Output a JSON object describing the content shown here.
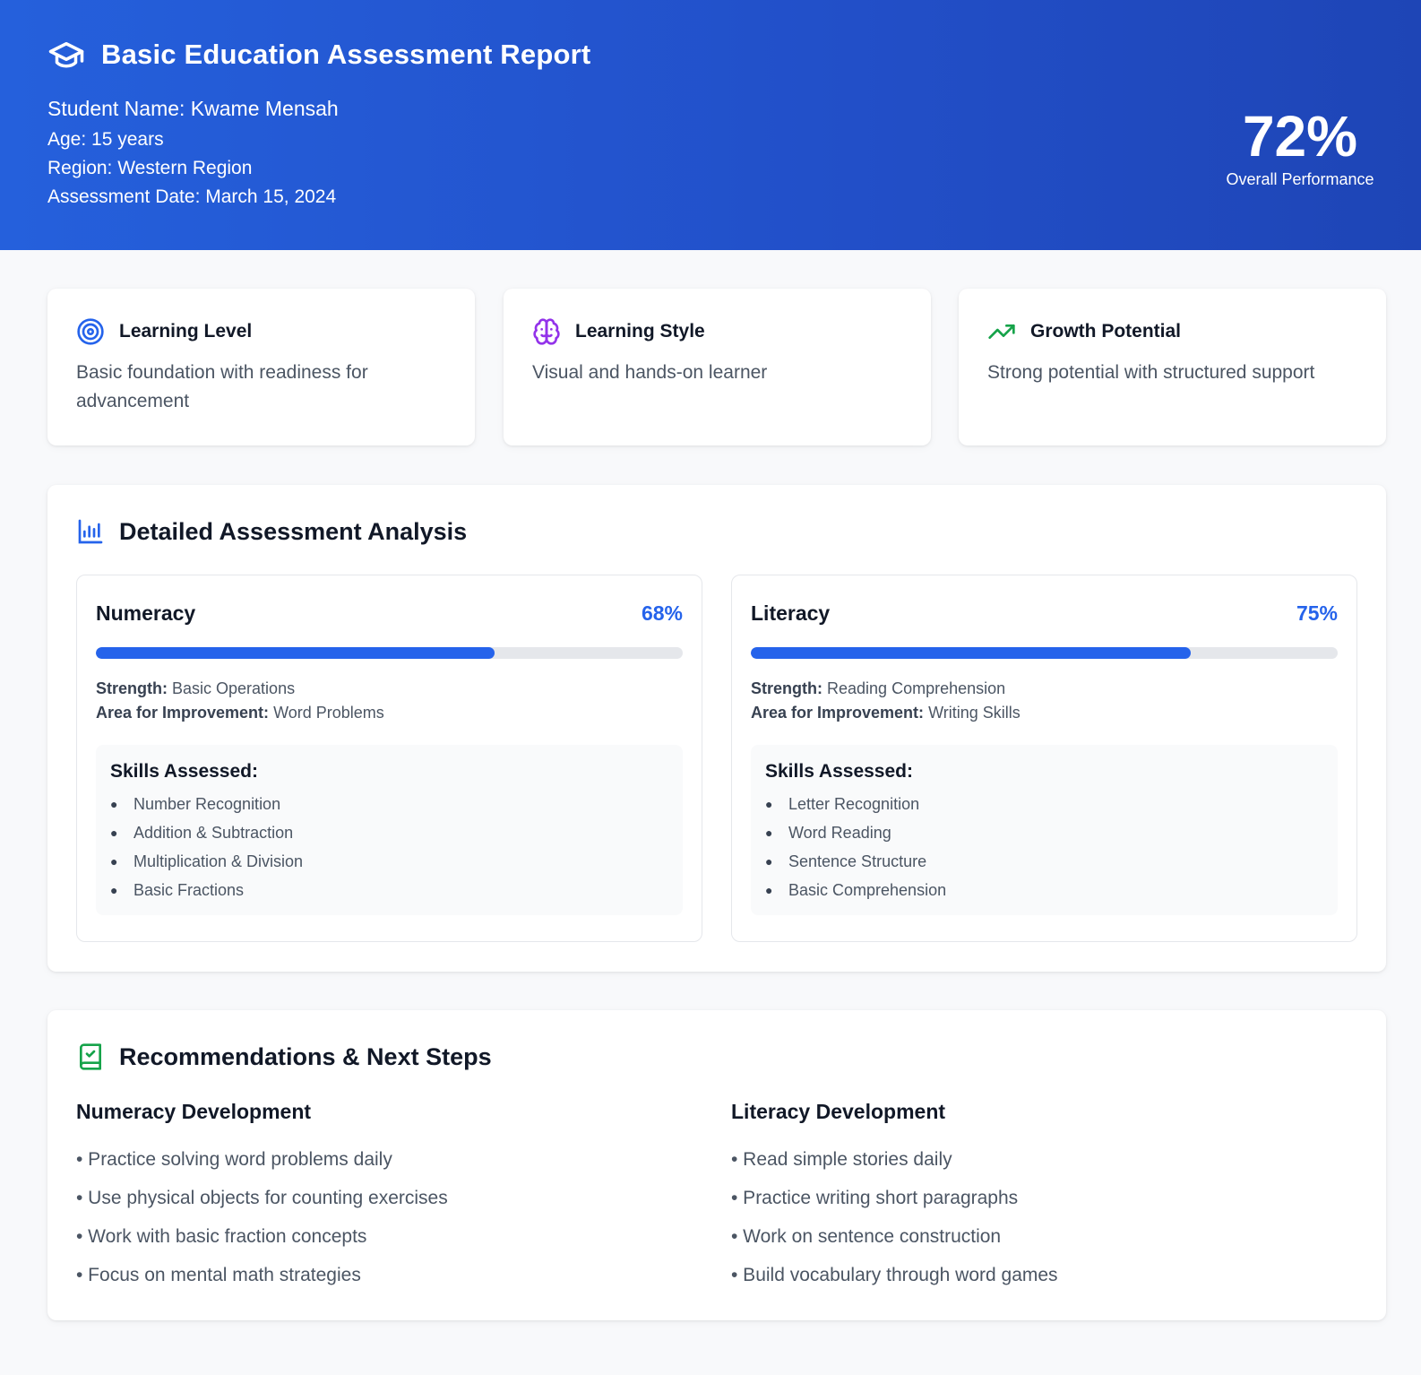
{
  "header": {
    "title": "Basic Education Assessment Report",
    "student_name": "Student Name: Kwame Mensah",
    "age": "Age: 15 years",
    "region": "Region: Western Region",
    "assessment_date": "Assessment Date: March 15, 2024",
    "overall_value": "72%",
    "overall_label": "Overall Performance",
    "icon": "graduation-cap-icon"
  },
  "info_cards": [
    {
      "title": "Learning Level",
      "text": "Basic foundation with readiness for advancement",
      "icon": "target-icon",
      "color": "#2563eb"
    },
    {
      "title": "Learning Style",
      "text": "Visual and hands-on learner",
      "icon": "brain-icon",
      "color": "#9333ea"
    },
    {
      "title": "Growth Potential",
      "text": "Strong potential with structured support",
      "icon": "trending-up-icon",
      "color": "#16a34a"
    }
  ],
  "analysis": {
    "title": "Detailed Assessment Analysis",
    "icon": "bar-chart-icon",
    "strength_label": "Strength:",
    "improvement_label": "Area for Improvement:",
    "skills_label": "Skills Assessed:",
    "subjects": [
      {
        "name": "Numeracy",
        "percent_text": "68%",
        "percent": 68,
        "strength": "Basic Operations",
        "improvement": "Word Problems",
        "skills": [
          "Number Recognition",
          "Addition & Subtraction",
          "Multiplication & Division",
          "Basic Fractions"
        ]
      },
      {
        "name": "Literacy",
        "percent_text": "75%",
        "percent": 75,
        "strength": "Reading Comprehension",
        "improvement": "Writing Skills",
        "skills": [
          "Letter Recognition",
          "Word Reading",
          "Sentence Structure",
          "Basic Comprehension"
        ]
      }
    ]
  },
  "recommendations": {
    "title": "Recommendations & Next Steps",
    "icon": "book-check-icon",
    "columns": [
      {
        "title": "Numeracy Development",
        "items": [
          "• Practice solving word problems daily",
          "• Use physical objects for counting exercises",
          "• Work with basic fraction concepts",
          "• Focus on mental math strategies"
        ]
      },
      {
        "title": "Literacy Development",
        "items": [
          "• Read simple stories daily",
          "• Practice writing short paragraphs",
          "• Work on sentence construction",
          "• Build vocabulary through word games"
        ]
      }
    ]
  },
  "colors": {
    "accent": "#2563eb",
    "header_start": "#2560dc",
    "header_end": "#1e45b6",
    "progress_track": "#e5e7eb"
  }
}
